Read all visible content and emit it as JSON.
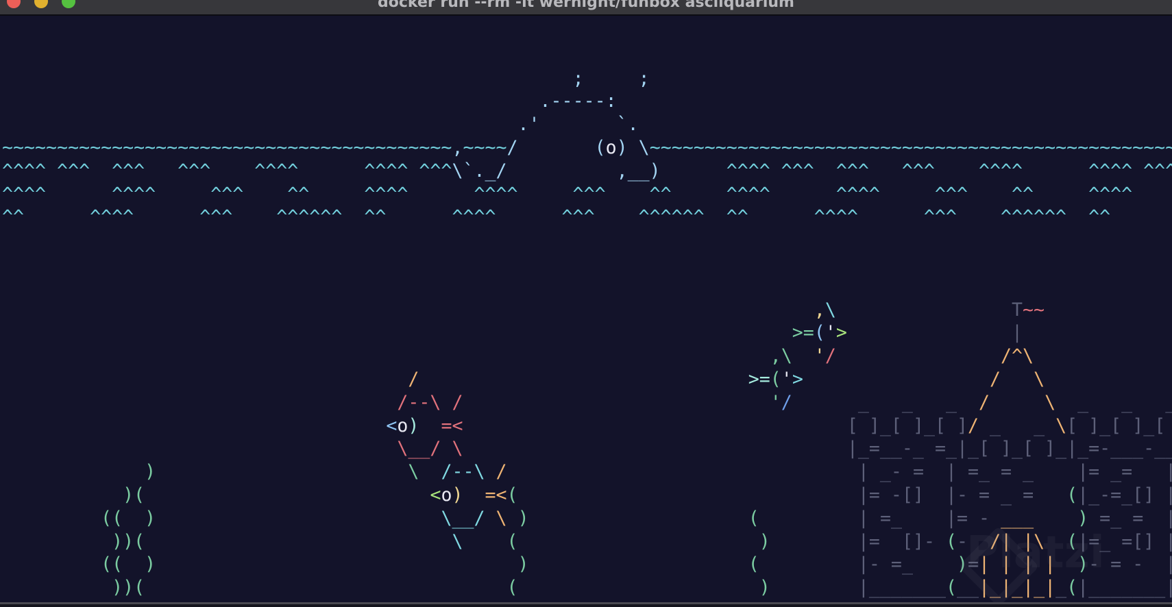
{
  "window": {
    "title": "docker run --rm -it wernight/funbox asciiquarium",
    "buttons": [
      "close",
      "minimize",
      "zoom"
    ]
  },
  "watermark": "Platzi",
  "palette": {
    "w": "#72cfdc",
    "wh": "#a3d4f2",
    "wt": "#e8e8f2",
    "r": "#e2727c",
    "o": "#efb474",
    "c": "#80d9e2",
    "g": "#7ccda2",
    "m": "#a6ebde",
    "lg": "#a9e57c",
    "lb": "#8fc4f2",
    "y": "#f1d893",
    "b": "#6f9fea",
    "cs": "#5d6079"
  },
  "terminal": {
    "rows": [
      [],
      [],
      [
        [
          "                                                    "
        ],
        [
          ";",
          "wh",
          "whale-spout"
        ],
        [
          "     "
        ],
        [
          ";",
          "wh",
          "whale-spout"
        ]
      ],
      [
        [
          "                                                 "
        ],
        [
          ".-----:",
          "wh",
          "whale"
        ]
      ],
      [
        [
          "                                               "
        ],
        [
          ".'",
          "wh",
          "whale"
        ],
        [
          "       "
        ],
        [
          "`.",
          "wh",
          "whale"
        ]
      ],
      [
        [
          "~~~~~~~~~~~~~~~~~~~~~~~~~~~~~~~~~~~~~~~~~",
          "w",
          "water-surface"
        ],
        [
          ",",
          "wh",
          "whale"
        ],
        [
          "~~~~",
          "w",
          "water-surface"
        ],
        [
          "/",
          "wh",
          "whale"
        ],
        [
          "       "
        ],
        [
          "(",
          "wh",
          "whale"
        ],
        [
          "o",
          "wt",
          "whale-eye"
        ],
        [
          ")",
          "wh",
          "whale"
        ],
        [
          " "
        ],
        [
          "\\",
          "wh",
          "whale"
        ],
        [
          "~~~~~~~~~~~~~~~~~~~~~~~~~~~~~~~~~~~~~~~~~~~~~~~~",
          "w",
          "water-surface"
        ]
      ],
      [
        [
          "^^^^ ^^^  ^^^   ^^^    ^^^^      ^^^^ ^^^",
          "w",
          "water-waves"
        ],
        [
          "\\`._/",
          "wh",
          "whale"
        ],
        [
          "          "
        ],
        [
          ",__)",
          "wh",
          "whale"
        ],
        [
          "      ^^^^ ^^^  ^^^   ^^^    ^^^^      ^^^^ ^^^",
          "w",
          "water-waves"
        ]
      ],
      [
        [
          "^^^^      ^^^^     ^^^    ^^     ^^^^      ^^^^     ^^^    ^^     ^^^^      ^^^^     ^^^    ^^     ^^^^    ",
          "w",
          "water-waves"
        ]
      ],
      [
        [
          "^^      ^^^^      ^^^    ^^^^^^  ^^      ^^^^      ^^^    ^^^^^^  ^^      ^^^^      ^^^    ^^^^^^  ^^      ",
          "w",
          "water-waves"
        ]
      ],
      [],
      [],
      [],
      [
        [
          "                                                                          "
        ],
        [
          ",",
          "y",
          "fish"
        ],
        [
          "\\",
          "c",
          "fish"
        ],
        [
          "                "
        ],
        [
          "T",
          "cs",
          "castle"
        ],
        [
          "~~",
          "r",
          "castle-flag"
        ]
      ],
      [
        [
          "                                                                        "
        ],
        [
          ">=",
          "g",
          "fish"
        ],
        [
          "(",
          "lb",
          "fish"
        ],
        [
          "'",
          "wt",
          "fish-eye"
        ],
        [
          ">",
          "lg",
          "fish"
        ],
        [
          "               "
        ],
        [
          "|",
          "cs",
          "castle"
        ]
      ],
      [
        [
          "                                                                      "
        ],
        [
          ",\\",
          "g",
          "fish"
        ],
        [
          "  "
        ],
        [
          "'",
          "y",
          "fish"
        ],
        [
          "/",
          "r",
          "fish"
        ],
        [
          "               "
        ],
        [
          "/^\\",
          "o",
          "castle-roof"
        ]
      ],
      [
        [
          "                                     "
        ],
        [
          "/",
          "o",
          "big-fish"
        ],
        [
          "                              "
        ],
        [
          ">=",
          "m",
          "fish"
        ],
        [
          "(",
          "g",
          "fish"
        ],
        [
          "'",
          "wt",
          "fish-eye"
        ],
        [
          ">",
          "c",
          "fish"
        ],
        [
          "                 "
        ],
        [
          "/",
          "o",
          "castle-roof"
        ],
        [
          "   "
        ],
        [
          "\\",
          "o",
          "castle-roof"
        ]
      ],
      [
        [
          "                                    "
        ],
        [
          "/--\\",
          "r",
          "big-fish"
        ],
        [
          " "
        ],
        [
          "/",
          "r",
          "big-fish"
        ],
        [
          "                            "
        ],
        [
          "'",
          "g",
          "fish"
        ],
        [
          "/",
          "b",
          "fish"
        ],
        [
          "     "
        ],
        [
          " _   _   _  ",
          "cs",
          "castle"
        ],
        [
          "/",
          "o",
          "castle-roof"
        ],
        [
          "     "
        ],
        [
          "\\",
          "o",
          "castle-roof"
        ],
        [
          "  _   _   _",
          "cs",
          "castle"
        ]
      ],
      [
        [
          "                                   "
        ],
        [
          "<",
          "lb",
          "big-fish"
        ],
        [
          "o",
          "wt",
          "big-fish-eye"
        ],
        [
          ")",
          "m",
          "big-fish"
        ],
        [
          "  "
        ],
        [
          "=<",
          "r",
          "big-fish"
        ],
        [
          "                                   "
        ],
        [
          "[ ]_[ ]_[ ]",
          "cs",
          "castle"
        ],
        [
          "/",
          "o",
          "castle-roof"
        ],
        [
          " _   _ ",
          "cs",
          "castle"
        ],
        [
          "\\",
          "o",
          "castle-roof"
        ],
        [
          "[ ]_[ ]_[ ",
          "cs",
          "castle"
        ]
      ],
      [
        [
          "                                    "
        ],
        [
          "\\__/",
          "r",
          "big-fish"
        ],
        [
          " "
        ],
        [
          "\\",
          "r",
          "big-fish"
        ],
        [
          "                                   "
        ],
        [
          "|_=__-_ =_|_[ ]_[ ]_|_=-___-__",
          "cs",
          "castle"
        ]
      ],
      [
        [
          "             "
        ],
        [
          ")",
          "g",
          "seaweed"
        ],
        [
          "                       "
        ],
        [
          "\\",
          "g",
          "big-fish"
        ],
        [
          "  "
        ],
        [
          "/--\\",
          "c",
          "big-fish"
        ],
        [
          " "
        ],
        [
          "/",
          "o",
          "big-fish"
        ],
        [
          "                               "
        ],
        [
          " | _- =  | =_ = _    |= _=   |",
          "cs",
          "castle"
        ]
      ],
      [
        [
          "           "
        ],
        [
          ")(",
          "g",
          "seaweed"
        ],
        [
          "                          "
        ],
        [
          "<",
          "lg",
          "big-fish"
        ],
        [
          "o",
          "wt",
          "big-fish-eye"
        ],
        [
          ")",
          "y",
          "big-fish"
        ],
        [
          "  "
        ],
        [
          "=<",
          "o",
          "big-fish"
        ],
        [
          "(",
          "g",
          "seaweed"
        ],
        [
          "                              "
        ],
        [
          " |= -[]  |- = _ =   ",
          "cs",
          "castle"
        ],
        [
          "(",
          "g",
          "seaweed"
        ],
        [
          "|_-=_[] |",
          "cs",
          "castle"
        ]
      ],
      [
        [
          "         "
        ],
        [
          "((",
          "g",
          "seaweed"
        ],
        [
          "  "
        ],
        [
          ")",
          "g",
          "seaweed"
        ],
        [
          "                          "
        ],
        [
          "\\__/",
          "c",
          "big-fish"
        ],
        [
          " "
        ],
        [
          "\\",
          "o",
          "big-fish"
        ],
        [
          " "
        ],
        [
          ")",
          "g",
          "seaweed"
        ],
        [
          "                    "
        ],
        [
          "(",
          "g",
          "seaweed"
        ],
        [
          "        "
        ],
        [
          " | =_    |= - ",
          "cs",
          "castle"
        ],
        [
          "___",
          "o",
          "castle-door"
        ],
        [
          "    "
        ],
        [
          ")",
          "g",
          "seaweed"
        ],
        [
          " =_ =  |",
          "cs",
          "castle"
        ]
      ],
      [
        [
          "          "
        ],
        [
          "))(",
          "g",
          "seaweed"
        ],
        [
          "                            "
        ],
        [
          "\\",
          "c",
          "big-fish"
        ],
        [
          "    "
        ],
        [
          "(",
          "g",
          "seaweed"
        ],
        [
          "                      "
        ],
        [
          ")",
          "g",
          "seaweed"
        ],
        [
          "       "
        ],
        [
          " |=  []- ",
          "cs",
          "castle"
        ],
        [
          "(",
          "g",
          "seaweed"
        ],
        [
          "-",
          "cs",
          "castle"
        ],
        [
          "  "
        ],
        [
          "/|",
          "o",
          "castle-door"
        ],
        [
          " "
        ],
        [
          "|\\",
          "o",
          "castle-door"
        ],
        [
          "  "
        ],
        [
          "(",
          "g",
          "seaweed"
        ],
        [
          "|=_ =[] |",
          "cs",
          "castle"
        ]
      ],
      [
        [
          "         "
        ],
        [
          "((",
          "g",
          "seaweed"
        ],
        [
          "  "
        ],
        [
          ")",
          "g",
          "seaweed"
        ],
        [
          "                                 "
        ],
        [
          ")",
          "g",
          "seaweed"
        ],
        [
          "                    "
        ],
        [
          "(",
          "g",
          "seaweed"
        ],
        [
          "        "
        ],
        [
          " |- =_    ",
          "cs",
          "castle"
        ],
        [
          ")",
          "g",
          "seaweed"
        ],
        [
          "=",
          "cs",
          "castle"
        ],
        [
          "| | | |",
          "o",
          "castle-door"
        ],
        [
          "  "
        ],
        [
          ")",
          "g",
          "seaweed"
        ],
        [
          "- = -  |",
          "cs",
          "castle"
        ]
      ],
      [
        [
          "          "
        ],
        [
          "))(",
          "g",
          "seaweed"
        ],
        [
          "                                 "
        ],
        [
          "(",
          "g",
          "seaweed"
        ],
        [
          "                      "
        ],
        [
          ")",
          "g",
          "seaweed"
        ],
        [
          "       "
        ],
        [
          " |_______",
          "cs",
          "castle"
        ],
        [
          "(",
          "g",
          "seaweed"
        ],
        [
          "__",
          "cs",
          "castle"
        ],
        [
          "|_|_|_|",
          "o",
          "castle-door"
        ],
        [
          "_",
          "cs",
          "castle"
        ],
        [
          "(",
          "g",
          "seaweed"
        ],
        [
          "|_______|",
          "cs",
          "castle"
        ]
      ]
    ]
  }
}
